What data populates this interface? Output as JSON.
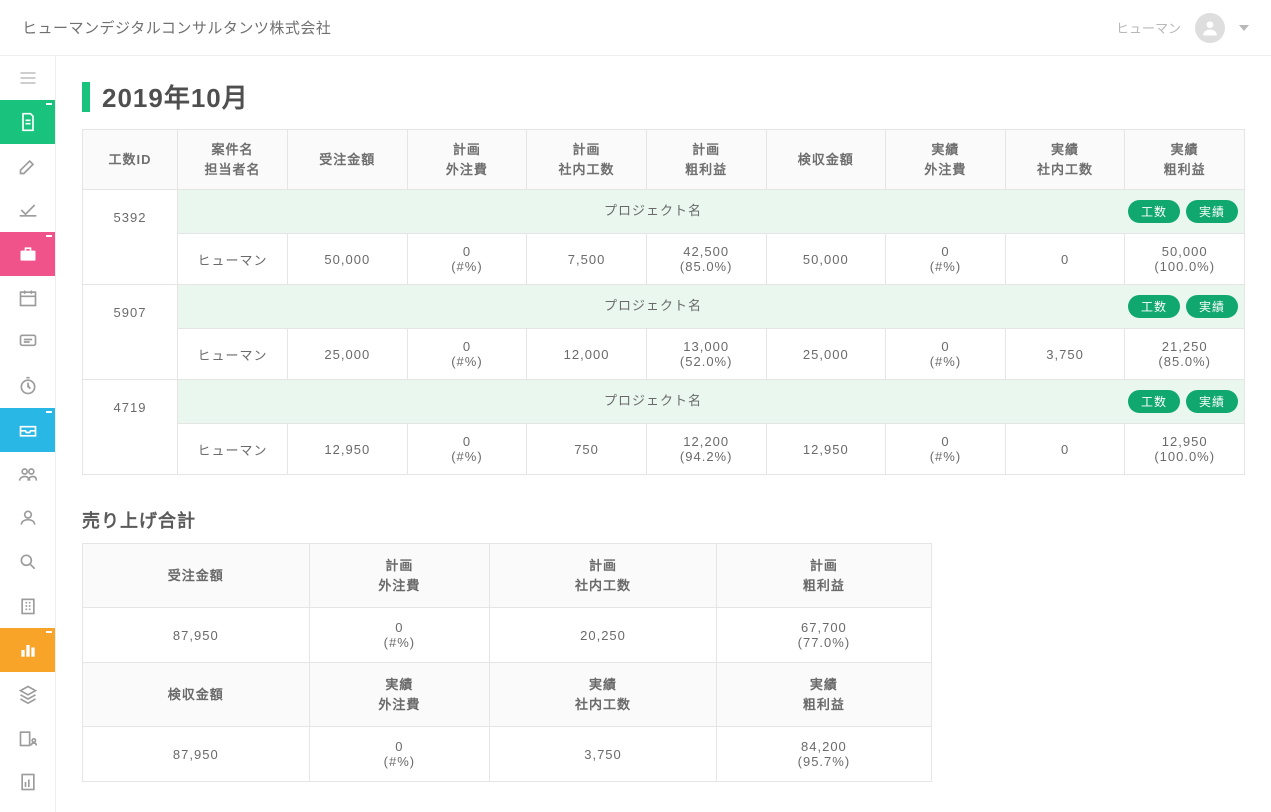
{
  "header": {
    "company": "ヒューマンデジタルコンサルタンツ株式会社",
    "username": "ヒューマン"
  },
  "page": {
    "title": "2019年10月"
  },
  "columns": {
    "c0": "工数ID",
    "c1a": "案件名",
    "c1b": "担当者名",
    "c2": "受注金額",
    "c3a": "計画",
    "c3b": "外注費",
    "c4a": "計画",
    "c4b": "社内工数",
    "c5a": "計画",
    "c5b": "粗利益",
    "c6": "検収金額",
    "c7a": "実績",
    "c7b": "外注費",
    "c8a": "実績",
    "c8b": "社内工数",
    "c9a": "実績",
    "c9b": "粗利益"
  },
  "labels": {
    "project_placeholder": "プロジェクト名",
    "pill_hours": "工数",
    "pill_actual": "実績",
    "hash_pct": "(#%)"
  },
  "projects": [
    {
      "id": "5392",
      "person": "ヒューマン",
      "order": "50,000",
      "plan_out": "0",
      "plan_in": "7,500",
      "plan_gp": "42,500",
      "plan_gp_pct": "(85.0%)",
      "accept": "50,000",
      "act_out": "0",
      "act_in": "0",
      "act_gp": "50,000",
      "act_gp_pct": "(100.0%)"
    },
    {
      "id": "5907",
      "person": "ヒューマン",
      "order": "25,000",
      "plan_out": "0",
      "plan_in": "12,000",
      "plan_gp": "13,000",
      "plan_gp_pct": "(52.0%)",
      "accept": "25,000",
      "act_out": "0",
      "act_in": "3,750",
      "act_gp": "21,250",
      "act_gp_pct": "(85.0%)"
    },
    {
      "id": "4719",
      "person": "ヒューマン",
      "order": "12,950",
      "plan_out": "0",
      "plan_in": "750",
      "plan_gp": "12,200",
      "plan_gp_pct": "(94.2%)",
      "accept": "12,950",
      "act_out": "0",
      "act_in": "0",
      "act_gp": "12,950",
      "act_gp_pct": "(100.0%)"
    }
  ],
  "summary_title": "売り上げ合計",
  "summary": {
    "h_order": "受注金額",
    "h_plan_out_a": "計画",
    "h_plan_out_b": "外注費",
    "h_plan_in_a": "計画",
    "h_plan_in_b": "社内工数",
    "h_plan_gp_a": "計画",
    "h_plan_gp_b": "粗利益",
    "order": "87,950",
    "plan_out": "0",
    "plan_out_pct": "(#%)",
    "plan_in": "20,250",
    "plan_gp": "67,700",
    "plan_gp_pct": "(77.0%)",
    "h_accept": "検収金額",
    "h_act_out_a": "実績",
    "h_act_out_b": "外注費",
    "h_act_in_a": "実績",
    "h_act_in_b": "社内工数",
    "h_act_gp_a": "実績",
    "h_act_gp_b": "粗利益",
    "accept": "87,950",
    "act_out": "0",
    "act_out_pct": "(#%)",
    "act_in": "3,750",
    "act_gp": "84,200",
    "act_gp_pct": "(95.7%)"
  }
}
